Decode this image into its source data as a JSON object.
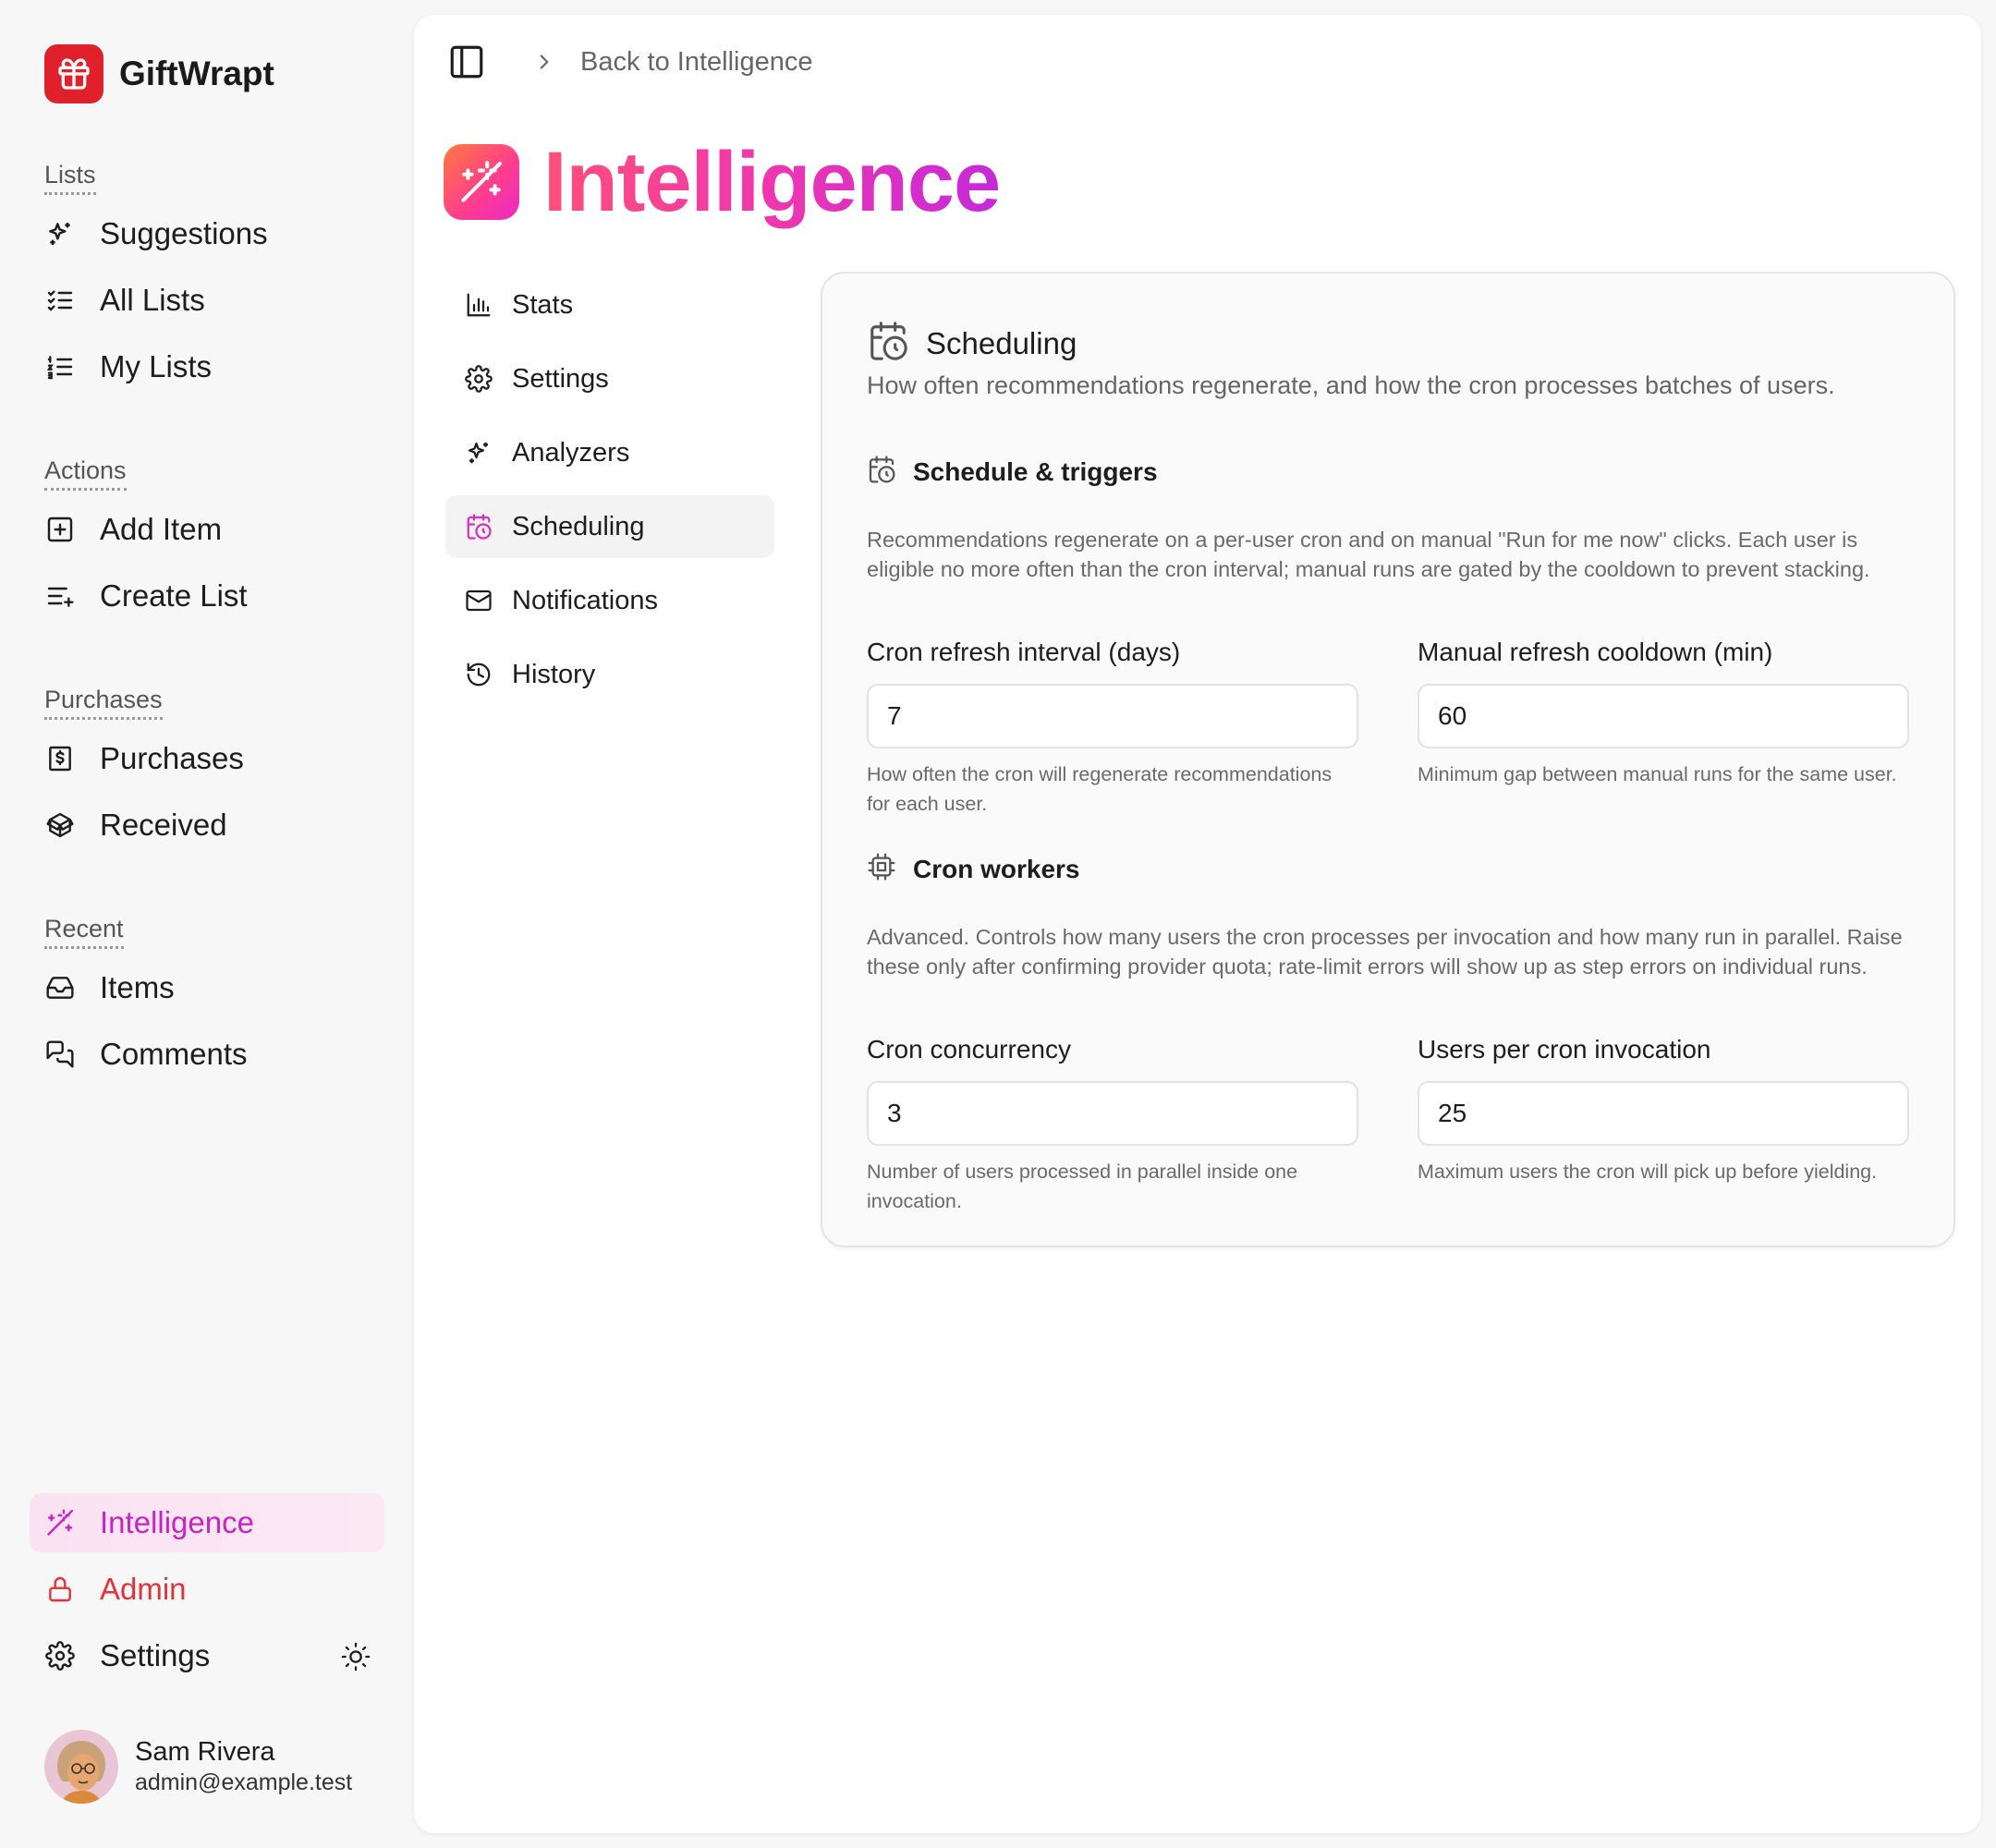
{
  "app": {
    "name": "GiftWrapt"
  },
  "sidebar": {
    "groups": [
      {
        "label": "Lists",
        "items": [
          {
            "label": "Suggestions"
          },
          {
            "label": "All Lists"
          },
          {
            "label": "My Lists"
          }
        ]
      },
      {
        "label": "Actions",
        "items": [
          {
            "label": "Add Item"
          },
          {
            "label": "Create List"
          }
        ]
      },
      {
        "label": "Purchases",
        "items": [
          {
            "label": "Purchases"
          },
          {
            "label": "Received"
          }
        ]
      },
      {
        "label": "Recent",
        "items": [
          {
            "label": "Items"
          },
          {
            "label": "Comments"
          }
        ]
      }
    ],
    "bottom": {
      "intelligence": "Intelligence",
      "admin": "Admin",
      "settings": "Settings"
    },
    "user": {
      "name": "Sam Rivera",
      "email": "admin@example.test"
    }
  },
  "breadcrumb": {
    "back_label": "Back to Intelligence"
  },
  "page": {
    "title": "Intelligence"
  },
  "subnav": [
    {
      "label": "Stats"
    },
    {
      "label": "Settings"
    },
    {
      "label": "Analyzers"
    },
    {
      "label": "Scheduling",
      "active": true
    },
    {
      "label": "Notifications"
    },
    {
      "label": "History"
    }
  ],
  "card": {
    "title": "Scheduling",
    "description": "How often recommendations regenerate, and how the cron processes batches of users.",
    "sections": [
      {
        "title": "Schedule & triggers",
        "description": "Recommendations regenerate on a per-user cron and on manual \"Run for me now\" clicks. Each user is eligible no more often than the cron interval; manual runs are gated by the cooldown to prevent stacking.",
        "fields": [
          {
            "label": "Cron refresh interval (days)",
            "value": "7",
            "help": "How often the cron will regenerate recommendations for each user."
          },
          {
            "label": "Manual refresh cooldown (min)",
            "value": "60",
            "help": "Minimum gap between manual runs for the same user."
          }
        ]
      },
      {
        "title": "Cron workers",
        "description": "Advanced. Controls how many users the cron processes per invocation and how many run in parallel. Raise these only after confirming provider quota; rate-limit errors will show up as step errors on individual runs.",
        "fields": [
          {
            "label": "Cron concurrency",
            "value": "3",
            "help": "Number of users processed in parallel inside one invocation."
          },
          {
            "label": "Users per cron invocation",
            "value": "25",
            "help": "Maximum users the cron will pick up before yielding."
          }
        ]
      }
    ]
  },
  "colors": {
    "brand": "#e0202a",
    "accent": "#d62fc7",
    "admin": "#e0343a"
  }
}
